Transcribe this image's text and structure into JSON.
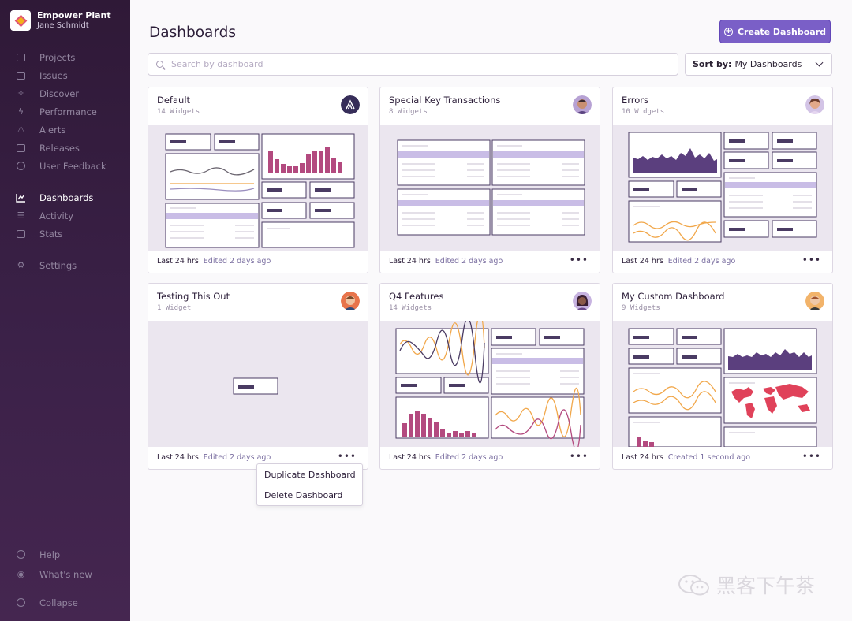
{
  "org": {
    "name": "Empower Plant",
    "user": "Jane Schmidt"
  },
  "nav": {
    "primary": [
      {
        "label": "Projects",
        "icon": "projects-icon"
      },
      {
        "label": "Issues",
        "icon": "issues-icon"
      },
      {
        "label": "Discover",
        "icon": "discover-icon"
      },
      {
        "label": "Performance",
        "icon": "performance-icon"
      },
      {
        "label": "Alerts",
        "icon": "alerts-icon"
      },
      {
        "label": "Releases",
        "icon": "releases-icon"
      },
      {
        "label": "User Feedback",
        "icon": "user-feedback-icon"
      }
    ],
    "secondary": [
      {
        "label": "Dashboards",
        "icon": "dashboards-icon",
        "active": true
      },
      {
        "label": "Activity",
        "icon": "activity-icon"
      },
      {
        "label": "Stats",
        "icon": "stats-icon"
      }
    ],
    "settings": {
      "label": "Settings",
      "icon": "settings-icon"
    },
    "bottom": [
      {
        "label": "Help",
        "icon": "help-icon"
      },
      {
        "label": "What's new",
        "icon": "broadcast-icon"
      },
      {
        "label": "Collapse",
        "icon": "collapse-icon"
      }
    ]
  },
  "header": {
    "title": "Dashboards",
    "create_button": "Create Dashboard"
  },
  "search": {
    "placeholder": "Search by dashboard",
    "value": ""
  },
  "sort": {
    "label": "Sort by:",
    "value": "My Dashboards"
  },
  "dashboards": [
    {
      "title": "Default",
      "widgets": "14 Widgets",
      "range": "Last 24 hrs",
      "edited": "Edited 2 days ago",
      "avatar": "sentry-logo-avatar"
    },
    {
      "title": "Special Key Transactions",
      "widgets": "8 Widgets",
      "range": "Last 24 hrs",
      "edited": "Edited 2 days ago",
      "avatar": "user-avatar"
    },
    {
      "title": "Errors",
      "widgets": "10 Widgets",
      "range": "Last 24 hrs",
      "edited": "Edited 2 days ago",
      "avatar": "user-avatar"
    },
    {
      "title": "Testing This Out",
      "widgets": "1 Widget",
      "range": "Last 24 hrs",
      "edited": "Edited 2 days ago",
      "avatar": "user-avatar"
    },
    {
      "title": "Q4 Features",
      "widgets": "14 Widgets",
      "range": "Last 24 hrs",
      "edited": "Edited 2 days ago",
      "avatar": "user-avatar"
    },
    {
      "title": "My Custom Dashboard",
      "widgets": "9 Widgets",
      "range": "Last 24 hrs",
      "edited": "Created 1 second ago",
      "avatar": "user-avatar"
    }
  ],
  "context_menu": {
    "items": [
      "Duplicate Dashboard",
      "Delete Dashboard"
    ]
  },
  "watermark": {
    "text": "黑客下午茶"
  },
  "colors": {
    "accent": "#7a5fc7",
    "sidebar": "#3b2148",
    "chart_purple": "#5b3f7e",
    "chart_pink": "#b34a7f",
    "chart_orange": "#f1a74a",
    "chart_red": "#e0425a"
  }
}
